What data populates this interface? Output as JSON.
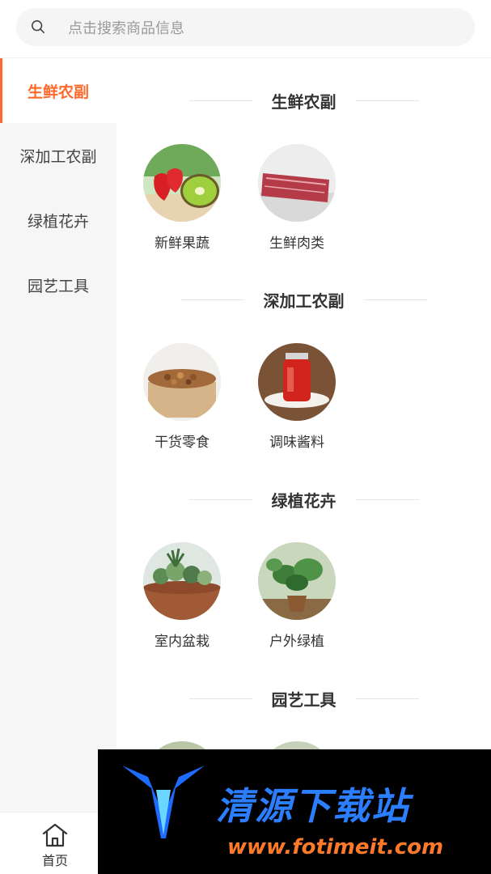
{
  "search": {
    "placeholder": "点击搜索商品信息"
  },
  "sidebar": {
    "items": [
      {
        "label": "生鲜农副",
        "active": true
      },
      {
        "label": "深加工农副",
        "active": false
      },
      {
        "label": "绿植花卉",
        "active": false
      },
      {
        "label": "园艺工具",
        "active": false
      }
    ]
  },
  "sections": [
    {
      "title": "生鲜农副",
      "items": [
        {
          "label": "新鲜果蔬",
          "icon": "fruit-image"
        },
        {
          "label": "生鲜肉类",
          "icon": "meat-image"
        }
      ]
    },
    {
      "title": "深加工农副",
      "items": [
        {
          "label": "干货零食",
          "icon": "nuts-image"
        },
        {
          "label": "调味酱料",
          "icon": "sauce-image"
        }
      ]
    },
    {
      "title": "绿植花卉",
      "items": [
        {
          "label": "室内盆栽",
          "icon": "succulent-image"
        },
        {
          "label": "户外绿植",
          "icon": "plant-image"
        }
      ]
    },
    {
      "title": "园艺工具",
      "items": []
    }
  ],
  "tabbar": {
    "home_label": "首页"
  },
  "watermark": {
    "logo_text": "清源下载站",
    "url": "www.fotimeit.com"
  },
  "colors": {
    "accent": "#ff6a2c",
    "sidebar_bg": "#f6f6f6"
  }
}
